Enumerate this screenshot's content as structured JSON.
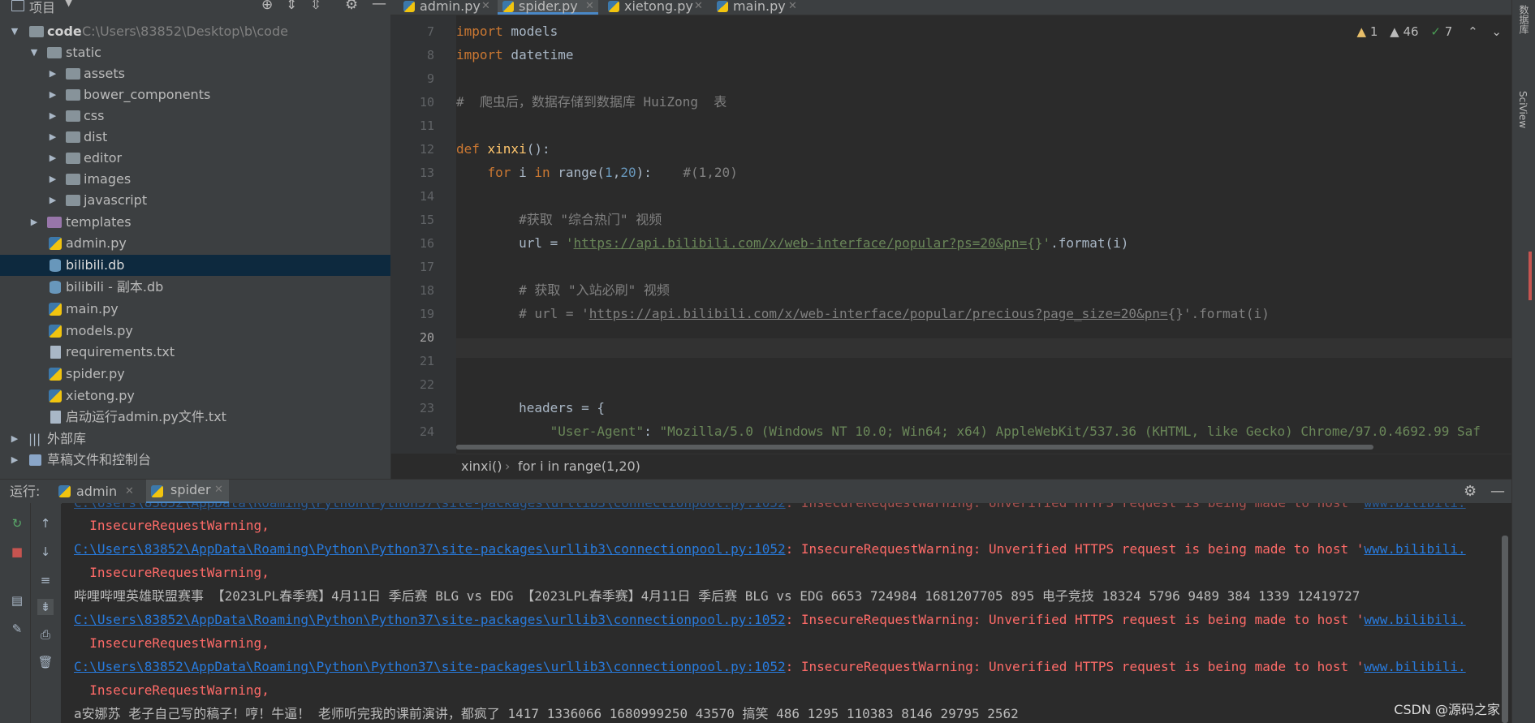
{
  "project_panel": {
    "title": "项目",
    "tree": [
      {
        "label": "code",
        "path": "C:\\Users\\83852\\Desktop\\b\\code",
        "kind": "folder",
        "expanded": true
      },
      {
        "label": "static",
        "kind": "folder",
        "expanded": true
      },
      {
        "label": "assets",
        "kind": "folder"
      },
      {
        "label": "bower_components",
        "kind": "folder"
      },
      {
        "label": "css",
        "kind": "folder"
      },
      {
        "label": "dist",
        "kind": "folder"
      },
      {
        "label": "editor",
        "kind": "folder"
      },
      {
        "label": "images",
        "kind": "folder"
      },
      {
        "label": "javascript",
        "kind": "folder"
      },
      {
        "label": "templates",
        "kind": "folder"
      },
      {
        "label": "admin.py",
        "kind": "py"
      },
      {
        "label": "bilibili.db",
        "kind": "db",
        "selected": true
      },
      {
        "label": "bilibili - 副本.db",
        "kind": "db"
      },
      {
        "label": "main.py",
        "kind": "py"
      },
      {
        "label": "models.py",
        "kind": "py"
      },
      {
        "label": "requirements.txt",
        "kind": "txt"
      },
      {
        "label": "spider.py",
        "kind": "py"
      },
      {
        "label": "xietong.py",
        "kind": "py"
      },
      {
        "label": "启动运行admin.py文件.txt",
        "kind": "txt"
      },
      {
        "label": "外部库",
        "kind": "lib"
      },
      {
        "label": "草稿文件和控制台",
        "kind": "scratch"
      }
    ]
  },
  "tabs": [
    {
      "label": "admin.py",
      "active": false
    },
    {
      "label": "spider.py",
      "active": true
    },
    {
      "label": "xietong.py",
      "active": false
    },
    {
      "label": "main.py",
      "active": false
    }
  ],
  "inspections": {
    "errors": "1",
    "warnings": "46",
    "ok": "7"
  },
  "editor": {
    "line_numbers": [
      "7",
      "8",
      "9",
      "10",
      "11",
      "12",
      "13",
      "14",
      "15",
      "16",
      "17",
      "18",
      "19",
      "20",
      "21",
      "22",
      "23",
      "24"
    ],
    "lines": {
      "l7_kw": "import",
      "l7_rest": " models",
      "l8_kw": "import",
      "l8_rest": " datetime",
      "l10": "#  爬虫后，数据存储到数据库 HuiZong  表",
      "l12_kw": "def ",
      "l12_fn": "xinxi",
      "l12_rest": "():",
      "l13_a": "    ",
      "l13_kw1": "for",
      "l13_b": " i ",
      "l13_kw2": "in",
      "l13_c": " range(",
      "l13_n1": "1",
      "l13_d": ",",
      "l13_n2": "20",
      "l13_e": "):    ",
      "l13_cm": "#(1,20)",
      "l15": "        #获取 \"综合热门\" 视频",
      "l16_a": "        url = ",
      "l16_q1": "'",
      "l16_url": "https://api.bilibili.com/x/web-interface/popular?ps=20&pn=",
      "l16_b": "{}",
      "l16_q2": "'",
      "l16_c": ".format(i)",
      "l18": "        # 获取 \"入站必刷\" 视频",
      "l19_a": "        # url = '",
      "l19_url": "https://api.bilibili.com/x/web-interface/popular/precious?page_size=20&pn=",
      "l19_b": "{}'.format(i)",
      "l23": "        headers = {",
      "l24_a": "            ",
      "l24_k": "\"User-Agent\"",
      "l24_b": ": ",
      "l24_v": "\"Mozilla/5.0 (Windows NT 10.0; Win64; x64) AppleWebKit/537.36 (KHTML, like Gecko) Chrome/97.0.4692.99 Saf"
    }
  },
  "breadcrumb": {
    "fn": "xinxi()",
    "sep": "›",
    "loop": "for i in range(1,20)"
  },
  "right_stripe": {
    "db": "数据库",
    "sci": "SciView"
  },
  "run_panel": {
    "label": "运行:",
    "tabs": [
      {
        "label": "admin"
      },
      {
        "label": "spider"
      }
    ]
  },
  "console": {
    "link_text": "C:\\Users\\83852\\AppData\\Roaming\\Python\\Python37\\site-packages\\urllib3\\connectionpool.py:1052",
    "warn_text": ": InsecureRequestWarning: Unverified HTTPS request is being made to host '",
    "host_text": "www.bilibili.",
    "short_warn": "  InsecureRequestWarning,",
    "data_line_1": "哔哩哔哩英雄联盟赛事 【2023LPL春季赛】4月11日 季后赛 BLG vs EDG 【2023LPL春季赛】4月11日 季后赛 BLG vs EDG 6653 724984 1681207705 895 电子竞技 18324 5796 9489 384 1339 12419727",
    "data_line_2": "a安娜苏 老子自己写的稿子！哼！牛逼！ 老师听完我的课前演讲，都疯了 1417 1336066 1680999250 43570 搞笑 486 1295 110383 8146 29795 2562"
  },
  "watermark": "CSDN @源码之家"
}
